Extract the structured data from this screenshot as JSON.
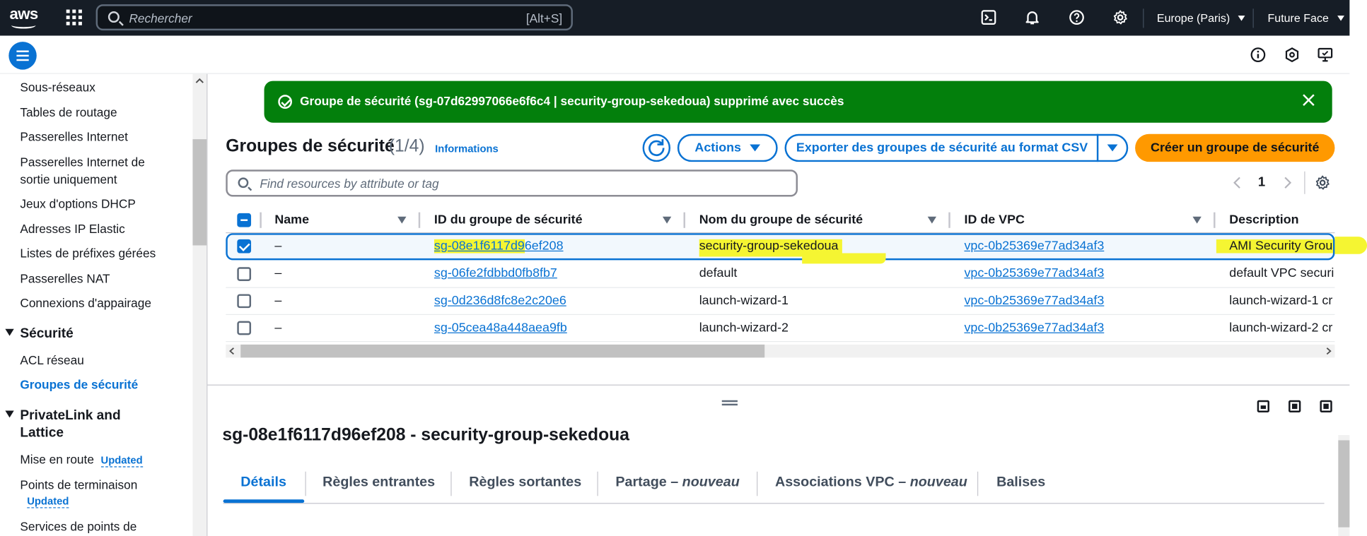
{
  "topnav": {
    "logo_text": "aws",
    "search_placeholder": "Rechercher",
    "search_shortcut": "[Alt+S]",
    "region": "Europe (Paris)",
    "account": "Future Face"
  },
  "sidebar": {
    "items_top": [
      "Sous-réseaux",
      "Tables de routage",
      "Passerelles Internet",
      "Passerelles Internet de",
      "sortie uniquement",
      "Jeux d'options DHCP",
      "Adresses IP Elastic",
      "Listes de préfixes gérées",
      "Passerelles NAT",
      "Connexions d'appairage"
    ],
    "section_security": "Sécurité",
    "security_items": [
      "ACL réseau",
      "Groupes de sécurité"
    ],
    "section_privatelink_1": "PrivateLink and",
    "section_privatelink_2": "Lattice",
    "privatelink_items": [
      "Mise en route",
      "Points de terminaison",
      "Services de points de"
    ],
    "badge_updated": "Updated"
  },
  "flash": {
    "message": "Groupe de sécurité (sg-07d62997066e6f6c4 | security-group-sekedoua) supprimé avec succès"
  },
  "header": {
    "title": "Groupes de sécurité",
    "count": "(1/4)",
    "info": "Informations",
    "actions": "Actions",
    "export": "Exporter des groupes de sécurité au format CSV",
    "create": "Créer un groupe de sécurité"
  },
  "filter": {
    "placeholder": "Find resources by attribute or tag"
  },
  "pager": {
    "current": "1"
  },
  "table": {
    "columns": [
      "Name",
      "ID du groupe de sécurité",
      "Nom du groupe de sécurité",
      "ID de VPC",
      "Description"
    ],
    "rows": [
      {
        "name": "–",
        "id_a": "sg-08e1f6117d9",
        "id_b": "6ef208",
        "group": "security-group-sekedoua",
        "vpc": "vpc-0b25369e77ad34af3",
        "desc": "AMI Security Group",
        "selected": true
      },
      {
        "name": "–",
        "id": "sg-06fe2fdbbd0fb8fb7",
        "group": "default",
        "vpc": "vpc-0b25369e77ad34af3",
        "desc": "default VPC securit",
        "selected": false
      },
      {
        "name": "–",
        "id": "sg-0d236d8fc8e2c20e6",
        "group": "launch-wizard-1",
        "vpc": "vpc-0b25369e77ad34af3",
        "desc": "launch-wizard-1 cr",
        "selected": false
      },
      {
        "name": "–",
        "id": "sg-05cea48a448aea9fb",
        "group": "launch-wizard-2",
        "vpc": "vpc-0b25369e77ad34af3",
        "desc": "launch-wizard-2 cr",
        "selected": false
      }
    ]
  },
  "split_panel": {
    "title": "sg-08e1f6117d96ef208 - security-group-sekedoua",
    "tabs": [
      {
        "label": "Détails"
      },
      {
        "label": "Règles entrantes"
      },
      {
        "label": "Règles sortantes"
      },
      {
        "label": "Partage – ",
        "em": "nouveau"
      },
      {
        "label": "Associations VPC – ",
        "em": "nouveau"
      },
      {
        "label": "Balises"
      }
    ]
  },
  "colors": {
    "nav_bg": "#161d26",
    "link": "#0972d3",
    "success": "#037f0c",
    "primary_button": "#ff9900",
    "highlight": "#f5f532"
  }
}
